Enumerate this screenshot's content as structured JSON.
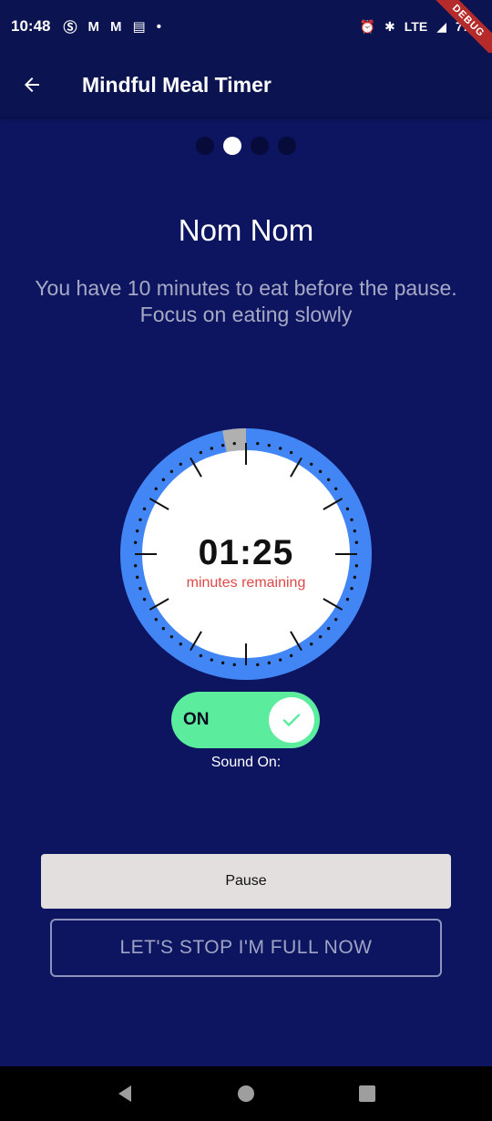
{
  "status_bar": {
    "time": "10:48",
    "battery": "77%",
    "network": "LTE",
    "debug_banner": "DEBUG",
    "notification_icons": [
      "s-icon",
      "gmail-icon",
      "gmail-icon",
      "message-icon",
      "dot-icon"
    ]
  },
  "app_bar": {
    "title": "Mindful Meal Timer"
  },
  "pager": {
    "count": 4,
    "active_index": 1
  },
  "content": {
    "title": "Nom Nom",
    "subtitle_line1": "You have 10 minutes to eat before the pause.",
    "subtitle_line2": "Focus on eating slowly"
  },
  "timer": {
    "time": "01:25",
    "label": "minutes remaining",
    "progress_remaining_fraction": 0.97,
    "colors": {
      "ring": "#4285f4",
      "elapsed": "#b0b0b0",
      "face": "#ffffff",
      "label": "#e04848"
    }
  },
  "sound_toggle": {
    "state_label": "ON",
    "caption": "Sound On:",
    "on": true,
    "color": "#5bec9e"
  },
  "buttons": {
    "pause": "Pause",
    "stop": "LET'S STOP I'M FULL NOW"
  },
  "colors": {
    "background": "#0d1560",
    "app_bar": "#0b1450"
  }
}
